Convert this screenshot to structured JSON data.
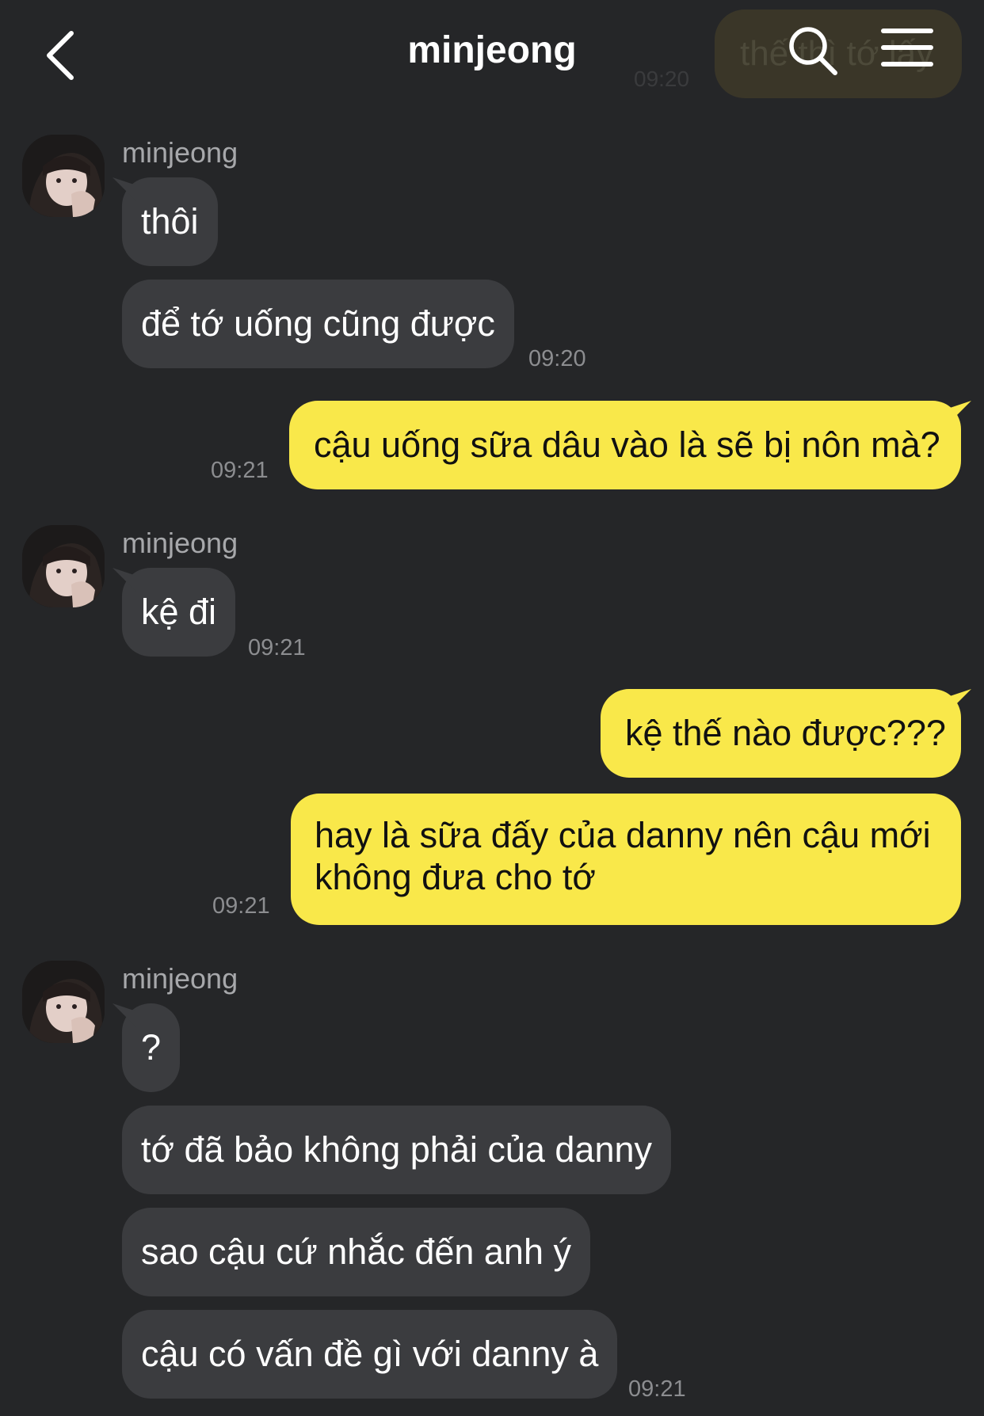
{
  "header": {
    "title": "minjeong",
    "ghost_bubble_text": "thế thì tớ lấy",
    "ghost_time": "09:20"
  },
  "messages": [
    {
      "sender": "minjeong",
      "bubbles": [
        "thôi",
        "để tớ uống cũng được"
      ],
      "time": "09:20"
    },
    {
      "outgoing": "cậu uống sữa dâu vào là sẽ bị nôn mà?",
      "time": "09:21"
    },
    {
      "sender": "minjeong",
      "bubbles": [
        "kệ đi"
      ],
      "time": "09:21"
    },
    {
      "outgoing_1": "kệ thế nào được???",
      "outgoing_2": "hay là sữa đấy của danny nên cậu mới không đưa cho tớ",
      "time": "09:21"
    },
    {
      "sender": "minjeong",
      "bubbles": [
        "?",
        "tớ đã bảo không phải của danny",
        "sao cậu cứ nhắc đến anh ý",
        "cậu có vấn đề gì với danny à"
      ],
      "time": "09:21"
    }
  ],
  "colors": {
    "background": "#252628",
    "incoming_bubble": "#3b3c3f",
    "outgoing_bubble": "#f9e84a"
  },
  "icons": [
    "back-arrow-icon",
    "search-icon",
    "menu-icon",
    "avatar"
  ]
}
